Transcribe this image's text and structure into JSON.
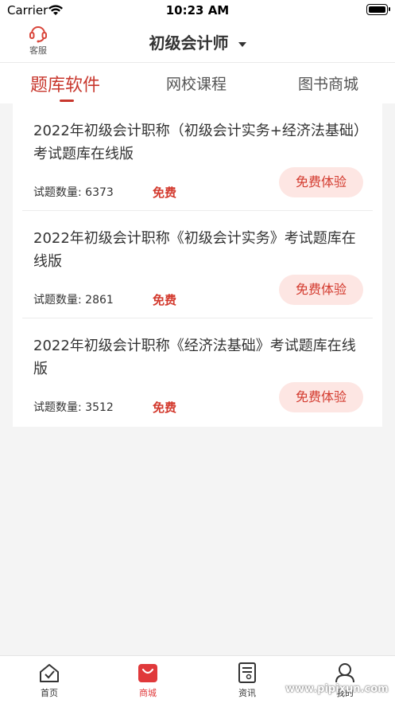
{
  "status_bar": {
    "carrier": "Carrier",
    "time": "10:23 AM"
  },
  "nav": {
    "service_label": "客服",
    "title": "初级会计师"
  },
  "tabs": [
    {
      "label": "题库软件",
      "active": true
    },
    {
      "label": "网校课程",
      "active": false
    },
    {
      "label": "图书商城",
      "active": false
    }
  ],
  "items": [
    {
      "title": "2022年初级会计职称（初级会计实务+经济法基础）考试题库在线版",
      "count": "试题数量: 6373",
      "price": "免费",
      "button": "免费体验"
    },
    {
      "title": "2022年初级会计职称《初级会计实务》考试题库在线版",
      "count": "试题数量: 2861",
      "price": "免费",
      "button": "免费体验"
    },
    {
      "title": "2022年初级会计职称《经济法基础》考试题库在线版",
      "count": "试题数量: 3512",
      "price": "免费",
      "button": "免费体验"
    }
  ],
  "tab_bar": [
    {
      "label": "首页",
      "icon": "home-icon"
    },
    {
      "label": "商城",
      "icon": "shop-bag-icon",
      "active": true
    },
    {
      "label": "资讯",
      "icon": "news-icon"
    },
    {
      "label": "我的",
      "icon": "user-icon"
    }
  ],
  "watermark": "www.pipixun.com",
  "colors": {
    "accent": "#c8372d",
    "button_bg": "#fde6e3",
    "page_bg": "#f4f4f4"
  }
}
